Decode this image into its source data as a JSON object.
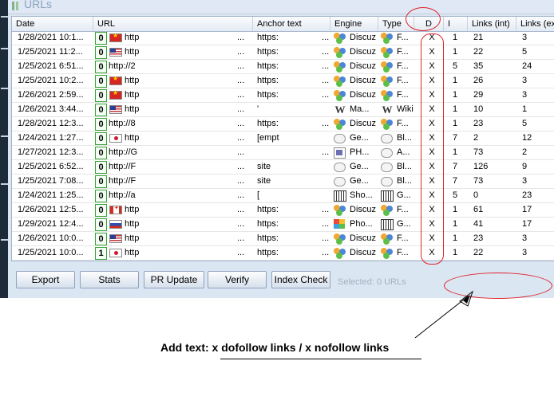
{
  "window": {
    "title": "URLs"
  },
  "columns": [
    "Date",
    "URL",
    "Anchor text",
    "Engine",
    "Type",
    "D",
    "I",
    "Links (int)",
    "Links (ext)"
  ],
  "rows": [
    {
      "date": "1/28/2021 10:1...",
      "score": "0",
      "flag": "cn",
      "url": "http",
      "url_tail": "...",
      "anchor": "https:",
      "anchor_tail": "...",
      "engine_icon": "discuz",
      "engine": "Discuz",
      "type_icon": "discuz",
      "type": "F...",
      "d": "X",
      "i": "1",
      "lint": "21",
      "lext": "3"
    },
    {
      "date": "1/25/2021 11:2...",
      "score": "0",
      "flag": "us",
      "url": "http",
      "url_tail": "...",
      "anchor": "https:",
      "anchor_tail": "...",
      "engine_icon": "discuz",
      "engine": "Discuz",
      "type_icon": "discuz",
      "type": "F...",
      "d": "X",
      "i": "1",
      "lint": "22",
      "lext": "5"
    },
    {
      "date": "1/25/2021 6:51...",
      "score": "0",
      "flag": "none",
      "url": "http://2",
      "url_tail": "...",
      "anchor": "https:",
      "anchor_tail": "...",
      "engine_icon": "discuz",
      "engine": "Discuz",
      "type_icon": "discuz",
      "type": "F...",
      "d": "X",
      "i": "5",
      "lint": "35",
      "lext": "24"
    },
    {
      "date": "1/25/2021 10:2...",
      "score": "0",
      "flag": "cn",
      "url": "http",
      "url_tail": "...",
      "anchor": "https:",
      "anchor_tail": "...",
      "engine_icon": "discuz",
      "engine": "Discuz",
      "type_icon": "discuz",
      "type": "F...",
      "d": "X",
      "i": "1",
      "lint": "26",
      "lext": "3"
    },
    {
      "date": "1/26/2021 2:59...",
      "score": "0",
      "flag": "cn",
      "url": "http",
      "url_tail": "...",
      "anchor": "https:",
      "anchor_tail": "...",
      "engine_icon": "discuz",
      "engine": "Discuz",
      "type_icon": "discuz",
      "type": "F...",
      "d": "X",
      "i": "1",
      "lint": "29",
      "lext": "3"
    },
    {
      "date": "1/26/2021 3:44...",
      "score": "0",
      "flag": "us",
      "url": "http",
      "url_tail": "...",
      "anchor": "'",
      "anchor_tail": "",
      "engine_icon": "wiki",
      "engine": "Ma...",
      "type_icon": "wiki",
      "type": "Wiki",
      "d": "X",
      "i": "1",
      "lint": "10",
      "lext": "1"
    },
    {
      "date": "1/28/2021 12:3...",
      "score": "0",
      "flag": "none",
      "url": "http://8",
      "url_tail": "...",
      "anchor": "https:",
      "anchor_tail": "...",
      "engine_icon": "discuz",
      "engine": "Discuz",
      "type_icon": "discuz",
      "type": "F...",
      "d": "X",
      "i": "1",
      "lint": "23",
      "lext": "5"
    },
    {
      "date": "1/24/2021 1:27...",
      "score": "0",
      "flag": "jp",
      "url": "http",
      "url_tail": "...",
      "anchor": "[empt",
      "anchor_tail": "",
      "engine_icon": "bubble",
      "engine": "Ge...",
      "type_icon": "bubble",
      "type": "Bl...",
      "d": "X",
      "i": "7",
      "lint": "2",
      "lext": "12"
    },
    {
      "date": "1/27/2021 12:3...",
      "score": "0",
      "flag": "none",
      "url": "http://G",
      "url_tail": "...",
      "anchor": "",
      "anchor_tail": "...",
      "engine_icon": "ph",
      "engine": "PH...",
      "type_icon": "bubble",
      "type": "A...",
      "d": "X",
      "i": "1",
      "lint": "73",
      "lext": "2"
    },
    {
      "date": "1/25/2021 6:52...",
      "score": "0",
      "flag": "none",
      "url": "http://F",
      "url_tail": "...",
      "anchor": "site",
      "anchor_tail": "",
      "engine_icon": "bubble",
      "engine": "Ge...",
      "type_icon": "bubble",
      "type": "Bl...",
      "d": "X",
      "i": "7",
      "lint": "126",
      "lext": "9"
    },
    {
      "date": "1/25/2021 7:08...",
      "score": "0",
      "flag": "none",
      "url": "http://F",
      "url_tail": "...",
      "anchor": "site",
      "anchor_tail": "",
      "engine_icon": "bubble",
      "engine": "Ge...",
      "type_icon": "bubble",
      "type": "Bl...",
      "d": "X",
      "i": "7",
      "lint": "73",
      "lext": "3"
    },
    {
      "date": "1/24/2021 1:25...",
      "score": "0",
      "flag": "none",
      "url": "http://a",
      "url_tail": "...",
      "anchor": "[",
      "anchor_tail": "",
      "engine_icon": "book",
      "engine": "Sho...",
      "type_icon": "book",
      "type": "G...",
      "d": "X",
      "i": "5",
      "lint": "0",
      "lext": "23"
    },
    {
      "date": "1/26/2021 12:5...",
      "score": "0",
      "flag": "ca",
      "url": "http",
      "url_tail": "...",
      "anchor": "https:",
      "anchor_tail": "...",
      "engine_icon": "discuz",
      "engine": "Discuz",
      "type_icon": "discuz",
      "type": "F...",
      "d": "X",
      "i": "1",
      "lint": "61",
      "lext": "17"
    },
    {
      "date": "1/29/2021 12:4...",
      "score": "0",
      "flag": "ru",
      "url": "http",
      "url_tail": "...",
      "anchor": "https:",
      "anchor_tail": "...",
      "engine_icon": "photo",
      "engine": "Pho...",
      "type_icon": "book",
      "type": "G...",
      "d": "X",
      "i": "1",
      "lint": "41",
      "lext": "17"
    },
    {
      "date": "1/26/2021 10:0...",
      "score": "0",
      "flag": "us",
      "url": "http",
      "url_tail": "...",
      "anchor": "https:",
      "anchor_tail": "...",
      "engine_icon": "discuz",
      "engine": "Discuz",
      "type_icon": "discuz",
      "type": "F...",
      "d": "X",
      "i": "1",
      "lint": "23",
      "lext": "3"
    },
    {
      "date": "1/25/2021 10:0...",
      "score": "1",
      "flag": "jp",
      "url": "http",
      "url_tail": "...",
      "anchor": "https:",
      "anchor_tail": "...",
      "engine_icon": "discuz",
      "engine": "Discuz",
      "type_icon": "discuz",
      "type": "F...",
      "d": "X",
      "i": "1",
      "lint": "22",
      "lext": "3"
    }
  ],
  "buttons": {
    "export": "Export",
    "stats": "Stats",
    "pr_update": "PR Update",
    "verify": "Verify",
    "index_check": "Index Check"
  },
  "status": {
    "selected": "Selected: 0 URLs"
  },
  "annotation": {
    "caption": "Add text: x dofollow links / x nofollow links",
    "color": "#e0222a"
  }
}
